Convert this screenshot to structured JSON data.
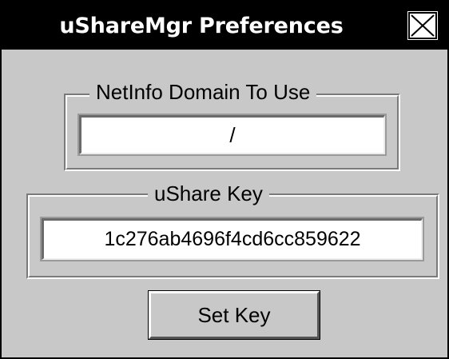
{
  "window": {
    "title": "uShareMgr Preferences"
  },
  "icons": {
    "close": "close-icon"
  },
  "netinfo": {
    "label": "NetInfo Domain To Use",
    "value": "/"
  },
  "ushare": {
    "label": "uShare Key",
    "value": "1c276ab4696f4cd6cc859622"
  },
  "buttons": {
    "set_key": "Set Key"
  },
  "colors": {
    "titlebar": "#000000",
    "title_text": "#ffffff",
    "panel": "#c8c8c8",
    "field": "#ffffff"
  }
}
